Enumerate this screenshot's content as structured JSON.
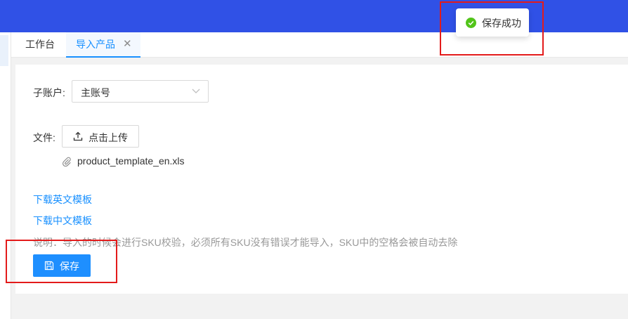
{
  "tabs": [
    {
      "label": "工作台"
    },
    {
      "label": "导入产品"
    }
  ],
  "form": {
    "subaccount_label": "子账户:",
    "subaccount_value": "主账号",
    "file_label": "文件:",
    "upload_label": "点击上传",
    "file_name": "product_template_en.xls",
    "link_en": "下载英文模板",
    "link_cn": "下载中文模板",
    "note": "说明：导入的时候会进行SKU校验，必须所有SKU没有错误才能导入，SKU中的空格会被自动去除",
    "save_label": "保存"
  },
  "toast": {
    "message": "保存成功",
    "status": "success"
  },
  "colors": {
    "topbar": "#3051e6",
    "primary": "#1890ff",
    "success": "#52c41a",
    "annotation": "#e31b1b"
  },
  "icons": {
    "close": "close-icon",
    "select_arrow": "chevron-down-icon",
    "upload": "upload-icon",
    "attachment": "paperclip-icon",
    "save": "save-icon",
    "toast": "check-circle-icon"
  }
}
